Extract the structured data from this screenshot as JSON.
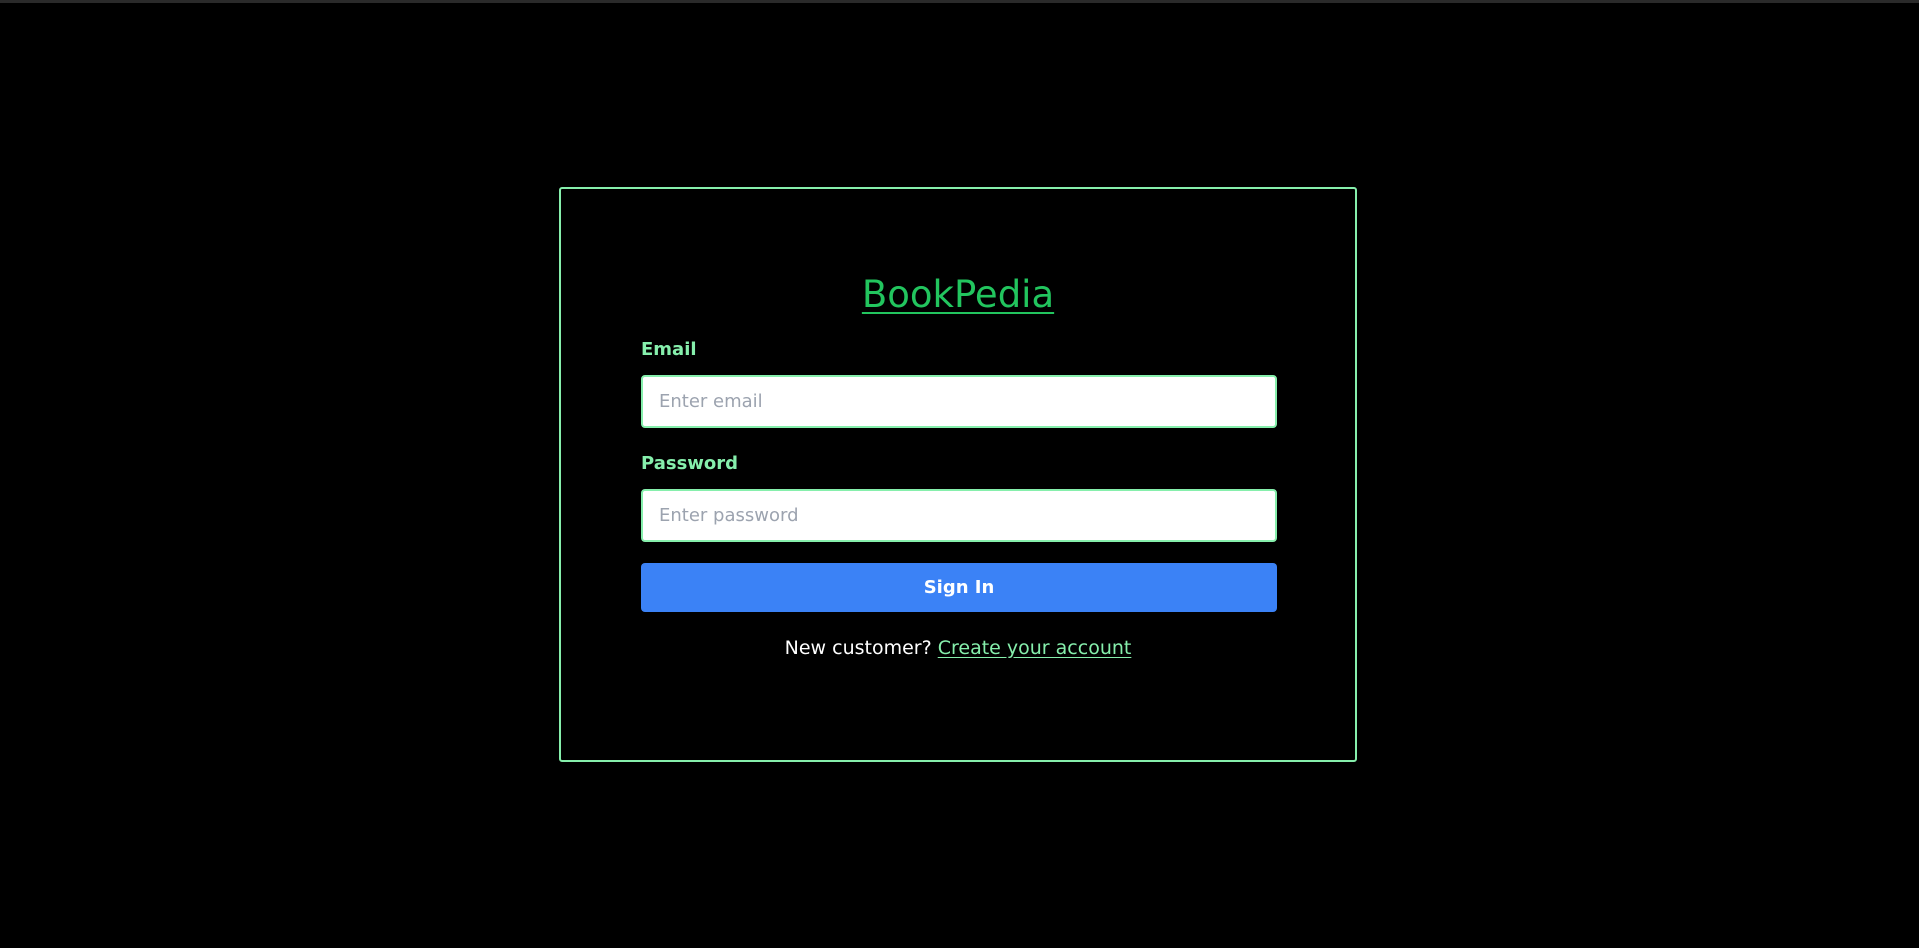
{
  "app": {
    "title": "BookPedia"
  },
  "form": {
    "email_label": "Email",
    "email_placeholder": "Enter email",
    "email_value": "",
    "password_label": "Password",
    "password_placeholder": "Enter password",
    "password_value": "",
    "submit_label": "Sign In"
  },
  "footer": {
    "prompt": "New customer? ",
    "link_label": "Create your account"
  },
  "colors": {
    "background": "#000000",
    "accent": "#86efac",
    "title": "#22c55e",
    "button": "#3b82f6"
  }
}
